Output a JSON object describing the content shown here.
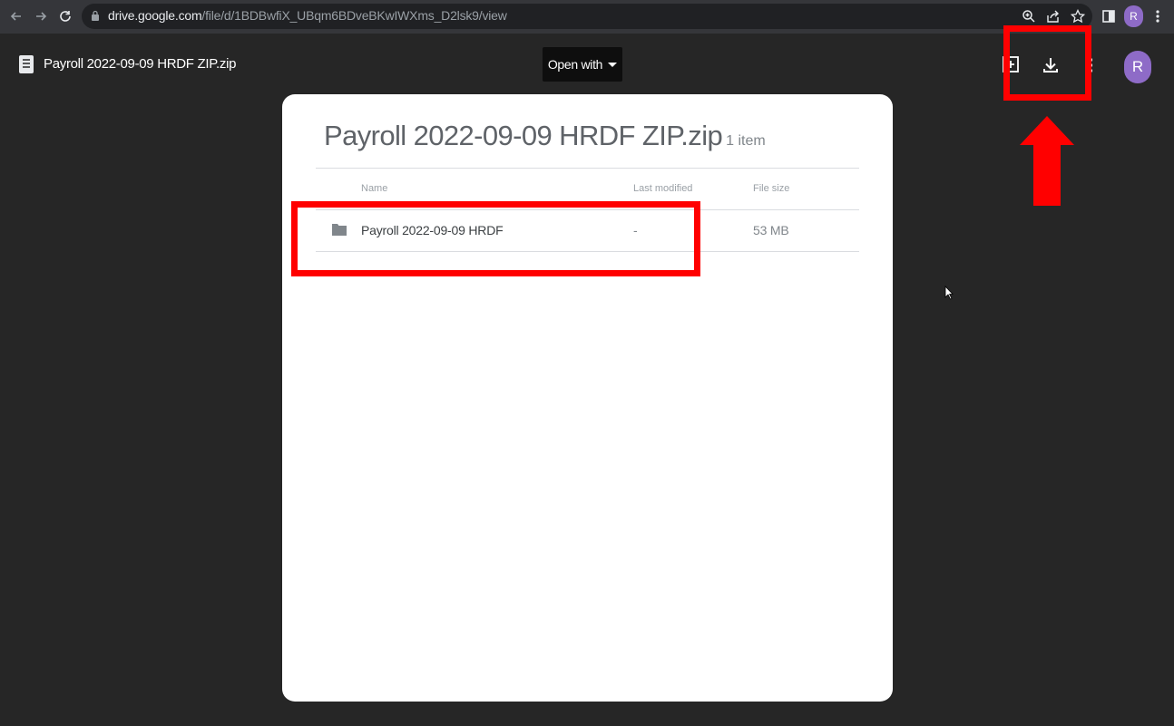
{
  "browser": {
    "url_host": "drive.google.com",
    "url_path": "/file/d/1BDBwfiX_UBqm6BDveBKwIWXms_D2lsk9/view",
    "profile_initial": "R"
  },
  "viewer": {
    "file_title": "Payroll 2022-09-09 HRDF ZIP.zip",
    "open_with_label": "Open with",
    "account_initial": "R"
  },
  "archive": {
    "title": "Payroll 2022-09-09 HRDF ZIP.zip",
    "item_count": "1 item",
    "columns": {
      "name": "Name",
      "modified": "Last modified",
      "size": "File size"
    },
    "rows": [
      {
        "name": "Payroll 2022-09-09 HRDF",
        "modified": "-",
        "size": "53 MB"
      }
    ]
  },
  "colors": {
    "highlight": "#ff0000",
    "avatar": "#8e6bc7",
    "background": "#262626"
  }
}
